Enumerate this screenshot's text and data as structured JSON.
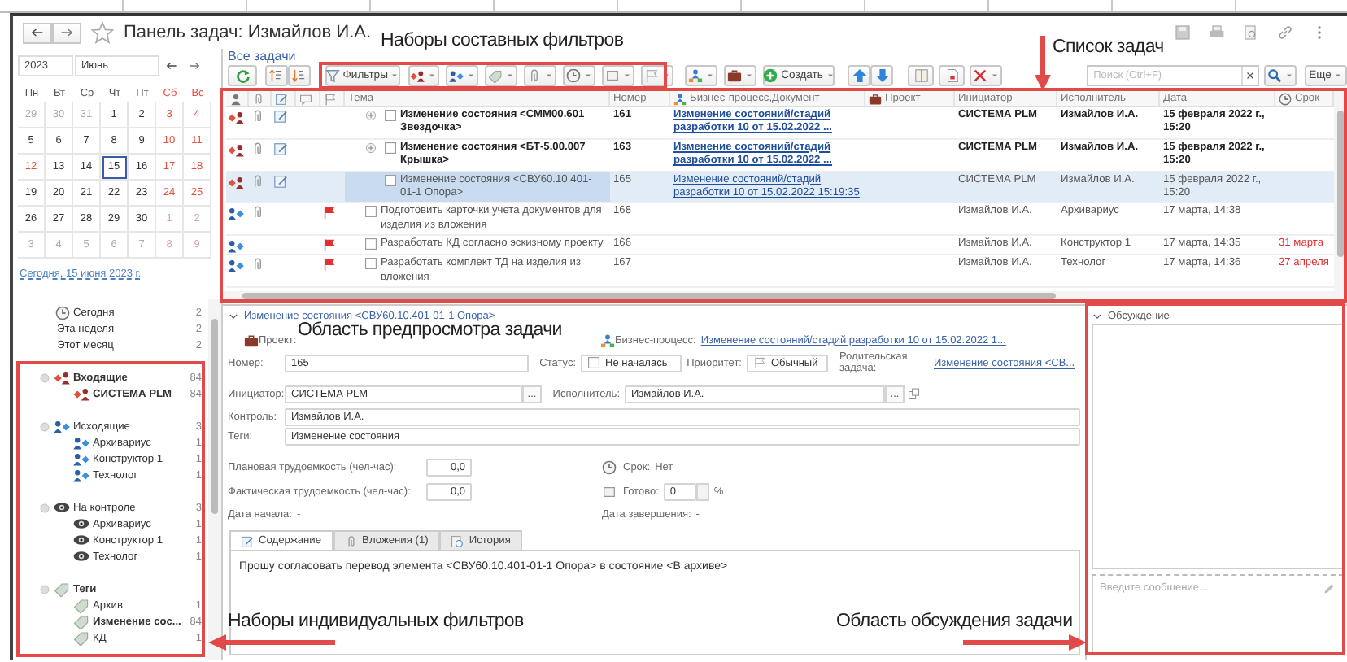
{
  "window": {
    "title": "Панель задач: Измайлов И.А.",
    "favorite": false
  },
  "calendar": {
    "year": "2023",
    "month": "Июнь",
    "weekdays": [
      {
        "label": "Пн",
        "weekend": false
      },
      {
        "label": "Вт",
        "weekend": false
      },
      {
        "label": "Ср",
        "weekend": false
      },
      {
        "label": "Чт",
        "weekend": false
      },
      {
        "label": "Пт",
        "weekend": false
      },
      {
        "label": "Сб",
        "weekend": true
      },
      {
        "label": "Вс",
        "weekend": true
      }
    ],
    "weeks": [
      [
        {
          "day": "29",
          "muted": true,
          "weekend": false,
          "selected": false
        },
        {
          "day": "30",
          "muted": true,
          "weekend": false,
          "selected": false
        },
        {
          "day": "31",
          "muted": true,
          "weekend": false,
          "selected": false
        },
        {
          "day": "1",
          "muted": false,
          "weekend": false,
          "selected": false
        },
        {
          "day": "2",
          "muted": false,
          "weekend": false,
          "selected": false
        },
        {
          "day": "3",
          "muted": false,
          "weekend": true,
          "selected": false
        },
        {
          "day": "4",
          "muted": false,
          "weekend": true,
          "selected": false
        }
      ],
      [
        {
          "day": "5",
          "muted": false,
          "weekend": false,
          "selected": false
        },
        {
          "day": "6",
          "muted": false,
          "weekend": false,
          "selected": false
        },
        {
          "day": "7",
          "muted": false,
          "weekend": false,
          "selected": false
        },
        {
          "day": "8",
          "muted": false,
          "weekend": false,
          "selected": false
        },
        {
          "day": "9",
          "muted": false,
          "weekend": false,
          "selected": false
        },
        {
          "day": "10",
          "muted": false,
          "weekend": true,
          "selected": false
        },
        {
          "day": "11",
          "muted": false,
          "weekend": true,
          "selected": false
        }
      ],
      [
        {
          "day": "12",
          "muted": false,
          "weekend": true,
          "selected": false
        },
        {
          "day": "13",
          "muted": false,
          "weekend": false,
          "selected": false
        },
        {
          "day": "14",
          "muted": false,
          "weekend": false,
          "selected": false
        },
        {
          "day": "15",
          "muted": false,
          "weekend": false,
          "selected": true
        },
        {
          "day": "16",
          "muted": false,
          "weekend": false,
          "selected": false
        },
        {
          "day": "17",
          "muted": false,
          "weekend": true,
          "selected": false
        },
        {
          "day": "18",
          "muted": false,
          "weekend": true,
          "selected": false
        }
      ],
      [
        {
          "day": "19",
          "muted": false,
          "weekend": false,
          "selected": false
        },
        {
          "day": "20",
          "muted": false,
          "weekend": false,
          "selected": false
        },
        {
          "day": "21",
          "muted": false,
          "weekend": false,
          "selected": false
        },
        {
          "day": "22",
          "muted": false,
          "weekend": false,
          "selected": false
        },
        {
          "day": "23",
          "muted": false,
          "weekend": false,
          "selected": false
        },
        {
          "day": "24",
          "muted": false,
          "weekend": true,
          "selected": false
        },
        {
          "day": "25",
          "muted": false,
          "weekend": true,
          "selected": false
        }
      ],
      [
        {
          "day": "26",
          "muted": false,
          "weekend": false,
          "selected": false
        },
        {
          "day": "27",
          "muted": false,
          "weekend": false,
          "selected": false
        },
        {
          "day": "28",
          "muted": false,
          "weekend": false,
          "selected": false
        },
        {
          "day": "29",
          "muted": false,
          "weekend": false,
          "selected": false
        },
        {
          "day": "30",
          "muted": false,
          "weekend": false,
          "selected": false
        },
        {
          "day": "1",
          "muted": true,
          "weekend": true,
          "selected": false
        },
        {
          "day": "2",
          "muted": true,
          "weekend": true,
          "selected": false
        }
      ],
      [
        {
          "day": "3",
          "muted": true,
          "weekend": false,
          "selected": false
        },
        {
          "day": "4",
          "muted": true,
          "weekend": false,
          "selected": false
        },
        {
          "day": "5",
          "muted": true,
          "weekend": false,
          "selected": false
        },
        {
          "day": "6",
          "muted": true,
          "weekend": false,
          "selected": false
        },
        {
          "day": "7",
          "muted": true,
          "weekend": false,
          "selected": false
        },
        {
          "day": "8",
          "muted": true,
          "weekend": true,
          "selected": false
        },
        {
          "day": "9",
          "muted": true,
          "weekend": true,
          "selected": false
        }
      ]
    ],
    "today_link": "Сегодня, 15 июня 2023 г."
  },
  "date_filters": [
    {
      "kind": "today",
      "label": "Сегодня",
      "count": "2"
    },
    {
      "kind": "week",
      "label": "Эта неделя",
      "count": "2"
    },
    {
      "kind": "month",
      "label": "Этот месяц",
      "count": "2"
    }
  ],
  "filter_groups": [
    {
      "kind": "incoming",
      "label": "Входящие",
      "count": "84",
      "bold": true,
      "children": [
        {
          "label": "СИСТЕМА PLM",
          "count": "84",
          "bold": true
        }
      ]
    },
    {
      "kind": "outgoing",
      "label": "Исходящие",
      "count": "3",
      "bold": false,
      "children": [
        {
          "label": "Архивариус",
          "count": "1",
          "bold": false
        },
        {
          "label": "Конструктор 1",
          "count": "1",
          "bold": false
        },
        {
          "label": "Технолог",
          "count": "1",
          "bold": false
        }
      ]
    },
    {
      "kind": "control",
      "label": "На контроле",
      "count": "3",
      "bold": false,
      "children": [
        {
          "label": "Архивариус",
          "count": "1",
          "bold": false
        },
        {
          "label": "Конструктор 1",
          "count": "1",
          "bold": false
        },
        {
          "label": "Технолог",
          "count": "1",
          "bold": false
        }
      ]
    },
    {
      "kind": "tags",
      "label": "Теги",
      "bold": true,
      "children": [
        {
          "label": "Архив",
          "count": "1",
          "bold": false
        },
        {
          "label": "Изменение сос...",
          "count": "84",
          "bold": true
        },
        {
          "label": "КД",
          "count": "1",
          "bold": false
        }
      ]
    }
  ],
  "view_link": "Все задачи",
  "toolbar": {
    "items": [
      {
        "kind": "refresh"
      },
      {
        "kind": "sort-asc"
      },
      {
        "kind": "sort-desc"
      },
      {
        "kind": "filter",
        "label": "Фильтры"
      },
      {
        "kind": "incoming"
      },
      {
        "kind": "outgoing"
      },
      {
        "kind": "tag"
      },
      {
        "kind": "clip"
      },
      {
        "kind": "clock"
      },
      {
        "kind": "square"
      },
      {
        "kind": "flag"
      },
      {
        "kind": "process"
      },
      {
        "kind": "briefcase"
      },
      {
        "kind": "create",
        "label": "Создать"
      },
      {
        "kind": "up"
      },
      {
        "kind": "down"
      },
      {
        "kind": "split"
      },
      {
        "kind": "report"
      },
      {
        "kind": "tools"
      }
    ],
    "search": {
      "placeholder": "Поиск (Ctrl+F)"
    },
    "more": "Еще"
  },
  "table": {
    "columns": [
      {
        "kind": "author"
      },
      {
        "kind": "attachment"
      },
      {
        "kind": "note"
      },
      {
        "kind": "comment"
      },
      {
        "kind": "flag"
      },
      {
        "kind": "topic",
        "label": "Тема"
      },
      {
        "kind": "number",
        "label": "Номер"
      },
      {
        "kind": "process",
        "label": "Бизнес-процесс,Документ"
      },
      {
        "kind": "project",
        "label": "Проект"
      },
      {
        "kind": "initiator",
        "label": "Инициатор"
      },
      {
        "kind": "executor",
        "label": "Исполнитель"
      },
      {
        "kind": "date",
        "label": "Дата"
      },
      {
        "kind": "due",
        "label": "Срок"
      }
    ],
    "rows": [
      {
        "kind": "incoming",
        "attachment": true,
        "note": true,
        "flag": false,
        "expandable": true,
        "checked": false,
        "topic": "Изменение состояния <СММ00.601 Звездочка>",
        "number": "161",
        "process": "Изменение состояний/стадий разработки 10 от 15.02.2022 ...",
        "initiator": "СИСТЕМА PLM",
        "executor": "Измайлов И.А.",
        "date": "15 февраля 2022 г., 15:20",
        "bold": true,
        "selected": false
      },
      {
        "kind": "incoming",
        "attachment": true,
        "note": true,
        "flag": false,
        "expandable": true,
        "checked": false,
        "topic": "Изменение состояния <БТ-5.00.007 Крышка>",
        "number": "163",
        "process": "Изменение состояний/стадий разработки 10 от 15.02.2022 ...",
        "initiator": "СИСТЕМА PLM",
        "executor": "Измайлов И.А.",
        "date": "15 февраля 2022 г., 15:20",
        "bold": true,
        "selected": false
      },
      {
        "kind": "incoming",
        "attachment": true,
        "note": true,
        "flag": false,
        "expandable": false,
        "checked": false,
        "topic": "Изменение состояния <СВУ60.10.401-01-1 Опора>",
        "number": "165",
        "process": "Изменение состояний/стадий разработки 10 от 15.02.2022 15:19:35",
        "initiator": "СИСТЕМА PLM",
        "executor": "Измайлов И.А.",
        "date": "15 февраля 2022 г., 15:20",
        "bold": false,
        "selected": true
      },
      {
        "kind": "outgoing",
        "attachment": true,
        "note": false,
        "flag": true,
        "checked": false,
        "topic": "Подготовить карточки учета документов для изделия из вложения",
        "number": "168",
        "initiator": "Измайлов И.А.",
        "executor": "Архивариус",
        "date": "17 марта, 14:38",
        "bold": false,
        "selected": false
      },
      {
        "kind": "outgoing",
        "attachment": false,
        "note": false,
        "flag": true,
        "checked": false,
        "topic": "Разработать КД согласно эскизному проекту",
        "number": "166",
        "initiator": "Измайлов И.А.",
        "executor": "Конструктор 1",
        "date": "17 марта, 14:35",
        "due": "31 марта",
        "bold": false,
        "selected": false,
        "overdue": true
      },
      {
        "kind": "outgoing",
        "attachment": true,
        "note": false,
        "flag": true,
        "checked": false,
        "topic": "Разработать комплект ТД на изделия из вложения",
        "number": "167",
        "initiator": "Измайлов И.А.",
        "executor": "Технолог",
        "date": "17 марта, 14:36",
        "due": "27 апреля",
        "bold": false,
        "selected": false,
        "overdue": true
      }
    ]
  },
  "preview": {
    "title": "Изменение состояния <СВУ60.10.401-01-1 Опора>",
    "project_label": "Проект:",
    "process_label": "Бизнес-процесс:",
    "process_link": "Изменение состояний/стадий разработки 10 от 15.02.2022 1...",
    "number": {
      "label": "Номер:",
      "value": "165"
    },
    "status": {
      "label": "Статус:",
      "value": "Не началась",
      "checked": false
    },
    "priority": {
      "label": "Приоритет:",
      "value": "Обычный"
    },
    "parent": {
      "label": "Родительская задача:",
      "link": "Изменение состояния <СВ..."
    },
    "initiator": {
      "label": "Инициатор:",
      "value": "СИСТЕМА PLM",
      "select_button": "..."
    },
    "executor": {
      "label": "Исполнитель:",
      "value": "Измайлов И.А.",
      "select_button": "..."
    },
    "control": {
      "label": "Контроль:",
      "value": "Измайлов И.А."
    },
    "tags": {
      "label": "Теги:",
      "value": "Изменение состояния"
    },
    "planned": {
      "label": "Плановая трудоемкость (чел-час):",
      "value": "0,0"
    },
    "actual": {
      "label": "Фактическая трудоемкость (чел-час):",
      "value": "0,0"
    },
    "due": {
      "label": "Срок:",
      "value": "Нет"
    },
    "ready": {
      "label": "Готово:",
      "value": "0",
      "unit": "%"
    },
    "start": {
      "label": "Дата начала:",
      "value": "-"
    },
    "end": {
      "label": "Дата завершения:",
      "value": "-"
    },
    "tabs": [
      {
        "kind": "content",
        "label": "Содержание",
        "selected": true
      },
      {
        "kind": "attachments",
        "label": "Вложения (1)",
        "selected": false
      },
      {
        "kind": "history",
        "label": "История",
        "selected": false
      }
    ],
    "content": "Прошу согласовать перевод элемента <СВУ60.10.401-01-1 Опора> в состояние <В архиве>"
  },
  "discussion": {
    "title": "Обсуждение",
    "placeholder": "Введите сообщение..."
  },
  "annotations": [
    {
      "text": "Наборы составных фильтров"
    },
    {
      "text": "Список задач"
    },
    {
      "text": "Область предпросмотра задачи"
    },
    {
      "text": "Наборы индивидуальных фильтров"
    },
    {
      "text": "Область обсуждения задачи"
    }
  ]
}
